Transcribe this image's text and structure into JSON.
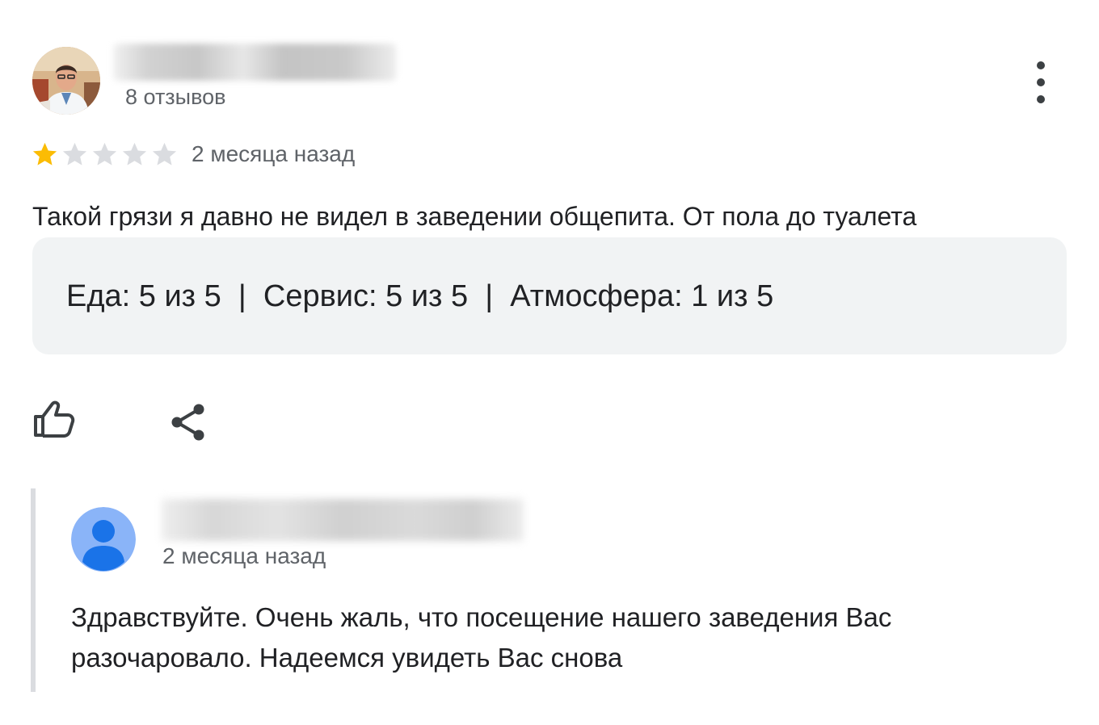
{
  "review": {
    "author": {
      "avatar_icon": "profile-photo",
      "reviews_count": "8 отзывов"
    },
    "menu_icon": "more-vert-icon",
    "rating": {
      "value": 1,
      "max": 5,
      "filled_color": "#fbbc04",
      "empty_color": "#dadce0"
    },
    "date": "2 месяца назад",
    "text": "Такой грязи я давно не видел в заведении общепита. От пола до туалета",
    "sub_ratings": "Еда: 5 из 5  |  Сервис: 5 из 5  |  Атмосфера: 1 из 5",
    "actions": {
      "like_icon": "thumb-up-icon",
      "share_icon": "share-icon"
    }
  },
  "owner_reply": {
    "avatar_icon": "person-icon",
    "avatar_color": "#8ab4f8",
    "date": "2 месяца назад",
    "text_lines": [
      "Здравствуйте. Очень жаль, что посещение нашего заведения Вас",
      "разочаровало. Надеемся увидеть Вас снова"
    ]
  }
}
